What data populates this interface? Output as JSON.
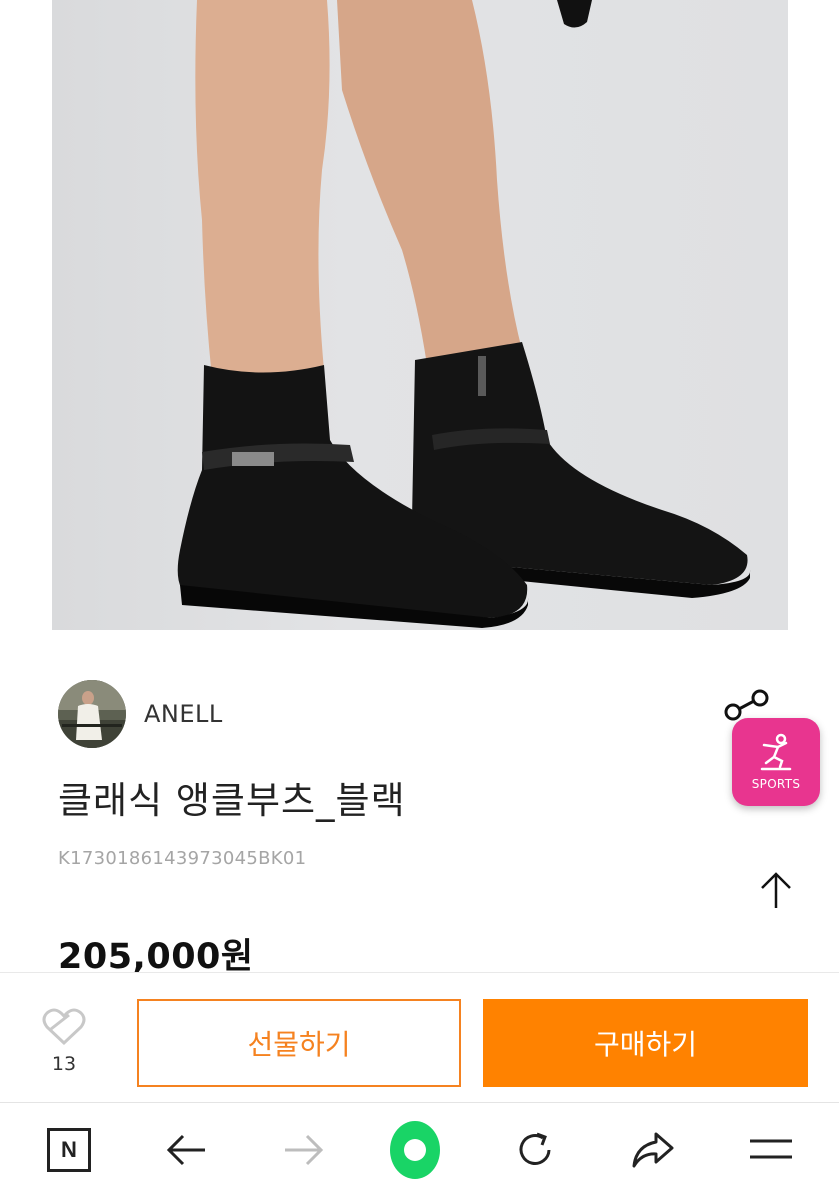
{
  "product": {
    "image_alt": "black ankle boots",
    "seller_name": "ANELL",
    "title": "클래식 앵클부츠_블랙",
    "sku": "K1730186143973045BK01",
    "price": "205,000원"
  },
  "badge": {
    "label": "SPORTS",
    "color": "#e8358f"
  },
  "purchase_bar": {
    "like_count": "13",
    "gift_label": "선물하기",
    "buy_label": "구매하기",
    "accent": "#ff8200"
  },
  "browser_bar": {
    "icons": [
      "naver-n-icon",
      "back-arrow-icon",
      "forward-arrow-icon",
      "green-circle-icon",
      "refresh-icon",
      "share-arrow-icon",
      "menu-icon"
    ],
    "n_label": "N"
  }
}
